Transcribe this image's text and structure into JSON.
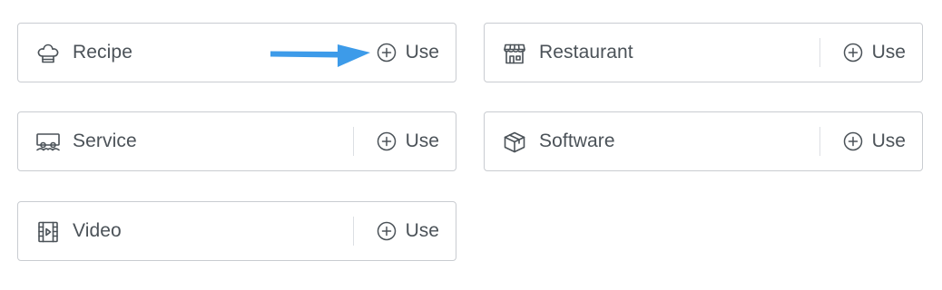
{
  "templates": [
    {
      "id": "recipe",
      "label": "Recipe",
      "icon": "chef-hat-icon",
      "action": "Use",
      "has_divider": false
    },
    {
      "id": "restaurant",
      "label": "Restaurant",
      "icon": "storefront-icon",
      "action": "Use",
      "has_divider": true
    },
    {
      "id": "service",
      "label": "Service",
      "icon": "service-icon",
      "action": "Use",
      "has_divider": true
    },
    {
      "id": "software",
      "label": "Software",
      "icon": "package-box-icon",
      "action": "Use",
      "has_divider": true
    },
    {
      "id": "video",
      "label": "Video",
      "icon": "film-strip-icon",
      "action": "Use",
      "has_divider": true
    }
  ],
  "annotation": {
    "icon": "arrow-right-icon",
    "color": "#3d9be9"
  },
  "colors": {
    "border": "#c9ccd1",
    "text": "#4b5258",
    "divider": "#dcdfe3"
  }
}
